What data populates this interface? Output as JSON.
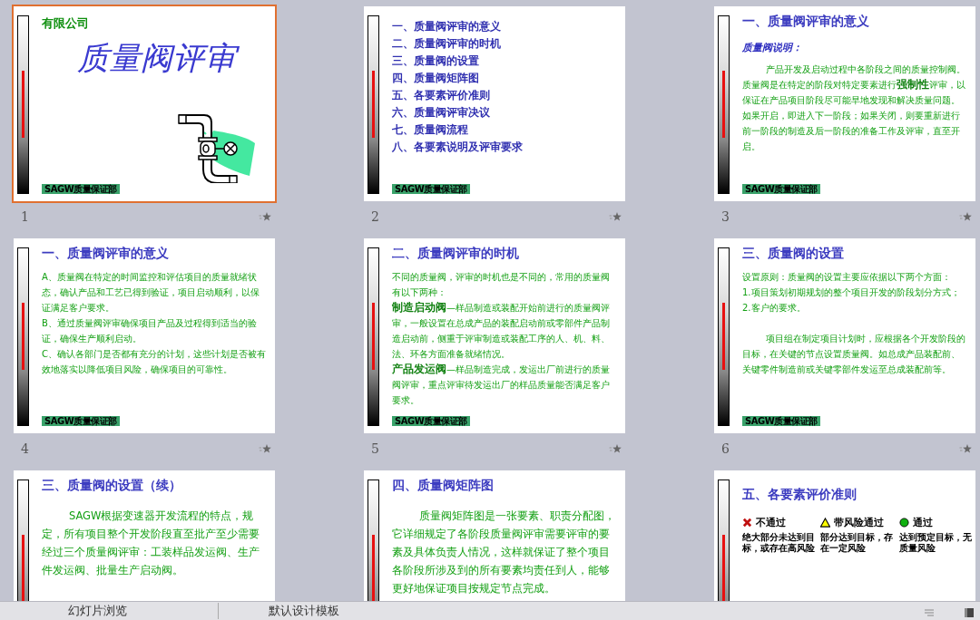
{
  "slides": [
    {
      "number": "1",
      "selected": true,
      "kind": "title",
      "company": "有限公司",
      "title": "质量阀评审",
      "footer": "SAGW质量保证部"
    },
    {
      "number": "2",
      "selected": false,
      "kind": "toc",
      "items": [
        "一、质量阀评审的意义",
        "二、质量阀评审的时机",
        "三、质量阀的设置",
        "四、质量阀矩阵图",
        "五、各要素评价准则",
        "六、质量阀评审决议",
        "七、质量阀流程",
        "八、各要素说明及评审要求"
      ],
      "footer": "SAGW质量保证部"
    },
    {
      "number": "3",
      "selected": false,
      "kind": "text",
      "title": "一、质量阀评审的意义",
      "subtitle": "质量阀说明：",
      "paragraphs": [
        {
          "kind": "indent",
          "text": "产品开发及启动过程中各阶段之间的质量控制阀。质量阀是在特定的阶段对特定要素进行**强制性**评审，以保证在产品项目阶段尽可能早地发现和解决质量问题。如果开启，即进入下一阶段；如果关闭，则要重新进行前一阶段的制造及后一阶段的准备工作及评审，直至开启。"
        }
      ],
      "footer": "SAGW质量保证部"
    },
    {
      "number": "4",
      "selected": false,
      "kind": "text",
      "title": "一、质量阀评审的意义",
      "paragraphs": [
        {
          "kind": "plain",
          "text": "A、质量阀在特定的时间监控和评估项目的质量就绪状态，确认产品和工艺已得到验证，项目启动顺利，以保证满足客户要求。"
        },
        {
          "kind": "plain",
          "text": "B、通过质量阀评审确保项目产品及过程得到适当的验证，确保生产顺利启动。"
        },
        {
          "kind": "plain",
          "text": "C、确认各部门是否都有充分的计划，这些计划是否被有效地落实以降低项目风险，确保项目的可靠性。"
        }
      ],
      "footer": "SAGW质量保证部"
    },
    {
      "number": "5",
      "selected": false,
      "kind": "text",
      "title": "二、质量阀评审的时机",
      "paragraphs": [
        {
          "kind": "plain",
          "text": "不同的质量阀，评审的时机也是不同的，常用的质量阀有以下两种："
        },
        {
          "kind": "plain",
          "text": "**制造启动阀**—样品制造或装配开始前进行的质量阀评审，一般设置在总成产品的装配启动前或零部件产品制造启动前，侧重于评审制造或装配工序的人、机、料、法、环各方面准备就绪情况。"
        },
        {
          "kind": "plain",
          "text": "**产品发运阀**—样品制造完成，发运出厂前进行的质量阀评审，重点评审待发运出厂的样品质量能否满足客户要求。"
        }
      ],
      "footer": "SAGW质量保证部"
    },
    {
      "number": "6",
      "selected": false,
      "kind": "text",
      "title": "三、质量阀的设置",
      "paragraphs": [
        {
          "kind": "plain",
          "text": "设置原则：质量阀的设置主要应依据以下两个方面："
        },
        {
          "kind": "plain",
          "text": "1.项目策划初期规划的整个项目开发的阶段划分方式；"
        },
        {
          "kind": "gap",
          "text": "2.客户的要求。"
        },
        {
          "kind": "indent",
          "text": "项目组在制定项目计划时，应根据各个开发阶段的目标，在关键的节点设置质量阀。如总成产品装配前、关键零件制造前或关键零部件发运至总成装配前等。"
        }
      ],
      "footer": "SAGW质量保证部"
    },
    {
      "kind": "text-large",
      "selected": false,
      "title": "三、质量阀的设置（续）",
      "paragraphs": [
        {
          "kind": "indent",
          "text": "SAGW根据变速器开发流程的特点，规定，所有项目整个开发阶段直至批产至少需要经过三个质量阀评审：工装样品发运阀、生产件发运阀、批量生产启动阀。"
        }
      ]
    },
    {
      "kind": "text-large",
      "selected": false,
      "title": "四、质量阀矩阵图",
      "paragraphs": [
        {
          "kind": "indent",
          "text": "质量阀矩阵图是一张要素、职责分配图，它详细规定了各阶段质量阀评审需要评审的要素及具体负责人情况，这样就保证了整个项目各阶段所涉及到的所有要素均责任到人，能够更好地保证项目按规定节点完成。"
        }
      ]
    },
    {
      "kind": "criteria",
      "selected": false,
      "title": "五、各要素评价准则",
      "criteria": [
        {
          "kind": "fail",
          "label": "不通过",
          "description": "绝大部分未达到目标，或存在高风险"
        },
        {
          "kind": "risk",
          "label": "带风险通过",
          "description": "部分达到目标，存在一定风险"
        },
        {
          "kind": "pass",
          "label": "通过",
          "description": "达到预定目标，无质量风险"
        }
      ]
    }
  ],
  "status_bar": {
    "view": "幻灯片浏览",
    "template": "默认设计模板"
  }
}
